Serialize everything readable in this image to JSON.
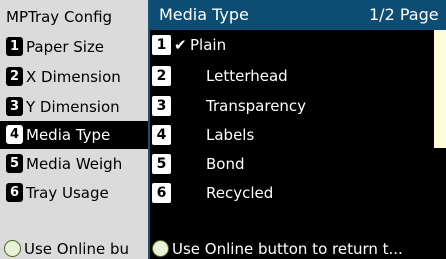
{
  "left_menu": {
    "title": "MPTray Config",
    "items": [
      {
        "number": "1",
        "label": "Paper Size",
        "selected": false
      },
      {
        "number": "2",
        "label": "X Dimension",
        "selected": false
      },
      {
        "number": "3",
        "label": "Y Dimension",
        "selected": false
      },
      {
        "number": "4",
        "label": "Media Type",
        "selected": true
      },
      {
        "number": "5",
        "label": "Media Weigh",
        "selected": false
      },
      {
        "number": "6",
        "label": "Tray Usage",
        "selected": false
      }
    ],
    "footer": "Use Online bu"
  },
  "right_panel": {
    "title": "Media Type",
    "page_indicator": "1/2 Page",
    "options": [
      {
        "number": "1",
        "label": "Plain",
        "checked": true
      },
      {
        "number": "2",
        "label": "Letterhead",
        "checked": false
      },
      {
        "number": "3",
        "label": "Transparency",
        "checked": false
      },
      {
        "number": "4",
        "label": "Labels",
        "checked": false
      },
      {
        "number": "5",
        "label": "Bond",
        "checked": false
      },
      {
        "number": "6",
        "label": "Recycled",
        "checked": false
      }
    ],
    "footer": "Use Online button to return t..."
  },
  "colors": {
    "header_bg": "#0d4d73",
    "left_bg": "#cfcfcf",
    "right_bg": "#000000",
    "highlight": "#fffbd6"
  },
  "icons": {
    "check": "checkmark-icon",
    "online_button": "circle-button-icon"
  }
}
